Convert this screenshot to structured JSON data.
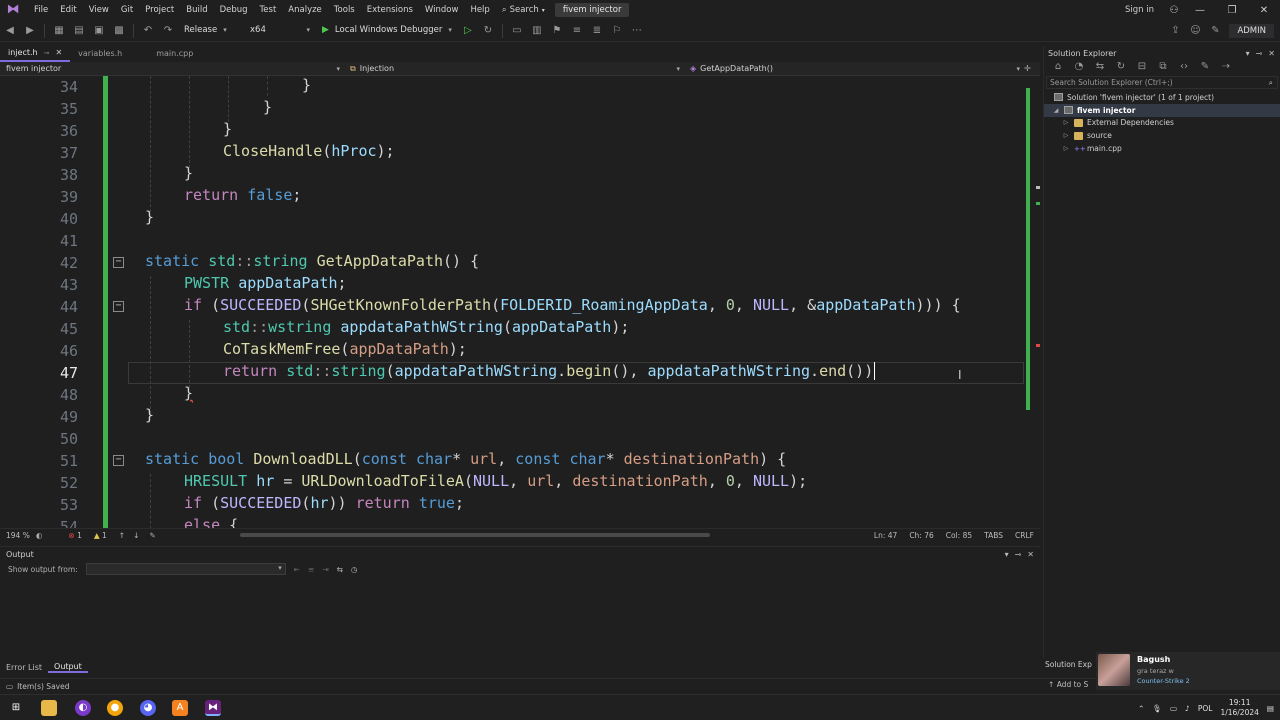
{
  "menubar": {
    "items": [
      "File",
      "Edit",
      "View",
      "Git",
      "Project",
      "Build",
      "Debug",
      "Test",
      "Analyze",
      "Tools",
      "Extensions",
      "Window",
      "Help"
    ],
    "search_label": "Search",
    "project_name": "fivem injector",
    "signin_label": "Sign in"
  },
  "toolbar": {
    "config": "Release",
    "platform": "x64",
    "debugger": "Local Windows Debugger",
    "admin_badge": "ADMIN"
  },
  "tabs": [
    {
      "label": "inject.h",
      "active": true
    },
    {
      "label": "variables.h",
      "active": false
    },
    {
      "label": "main.cpp",
      "active": false
    }
  ],
  "navbar": {
    "project": "fivem injector",
    "scope": "Injection",
    "member": "GetAppDataPath()"
  },
  "editor": {
    "line_numbers": [
      "34",
      "35",
      "36",
      "37",
      "38",
      "39",
      "40",
      "41",
      "42",
      "43",
      "44",
      "45",
      "46",
      "47",
      "48",
      "49",
      "50",
      "51",
      "52",
      "53",
      "54"
    ],
    "current_line": "47",
    "lines": {
      "l34": "}",
      "l35": "}",
      "l36": "}",
      "l37_fn": "CloseHandle",
      "l37_a": "(",
      "l37_v": "hProc",
      "l37_b": ");",
      "l38": "}",
      "l39_kw": "return",
      "l39_v": "false",
      "l39_e": ";",
      "l40": "}",
      "l42_kw": "static",
      "l42_ns": "std",
      "l42_sep": "::",
      "l42_ty": "string",
      "l42_fn": "GetAppDataPath",
      "l42_e": "() {",
      "l43_ty": "PWSTR",
      "l43_v": "appDataPath",
      "l43_e": ";",
      "l44_kw": "if",
      "l44_a": " (",
      "l44_m": "SUCCEEDED",
      "l44_b": "(",
      "l44_fn": "SHGetKnownFolderPath",
      "l44_c": "(",
      "l44_id": "FOLDERID_RoamingAppData",
      "l44_d": ", ",
      "l44_n": "0",
      "l44_f": ", ",
      "l44_nul": "NULL",
      "l44_g": ", &",
      "l44_v": "appDataPath",
      "l44_h": "))) {",
      "l45_ns": "std",
      "l45_sep": "::",
      "l45_ty": "wstring",
      "l45_fn": "appdataPathWString",
      "l45_a": "(",
      "l45_v": "appDataPath",
      "l45_b": ");",
      "l46_fn": "CoTaskMemFree",
      "l46_a": "(",
      "l46_v": "appDataPath",
      "l46_b": ");",
      "l47_kw": "return",
      "l47_ns": "std",
      "l47_sep": "::",
      "l47_ty": "string",
      "l47_a": "(",
      "l47_v1": "appdataPathWString",
      "l47_d1": ".",
      "l47_m1": "begin",
      "l47_b": "(), ",
      "l47_v2": "appdataPathWString",
      "l47_d2": ".",
      "l47_m2": "end",
      "l47_c": "())",
      "l48": "}",
      "l49": "}",
      "l51_kw": "static",
      "l51_ty": "bool",
      "l51_fn": "DownloadDLL",
      "l51_a": "(",
      "l51_k1": "const",
      "l51_t1": "char",
      "l51_s1": "* ",
      "l51_p1": "url",
      "l51_c": ", ",
      "l51_k2": "const",
      "l51_t2": "char",
      "l51_s2": "* ",
      "l51_p2": "destinationPath",
      "l51_e": ") {",
      "l52_ty": "HRESULT",
      "l52_v": "hr",
      "l52_eq": " = ",
      "l52_fn": "URLDownloadToFileA",
      "l52_a": "(",
      "l52_nul": "NULL",
      "l52_b": ", ",
      "l52_p1": "url",
      "l52_c": ", ",
      "l52_p2": "destinationPath",
      "l52_d": ", ",
      "l52_n": "0",
      "l52_e": ", ",
      "l52_nul2": "NULL",
      "l52_f": ");",
      "l53_kw": "if",
      "l53_a": " (",
      "l53_m": "SUCCEEDED",
      "l53_b": "(",
      "l53_v": "hr",
      "l53_c": ")) ",
      "l53_kw2": "return",
      "l53_t": "true",
      "l53_e": ";",
      "l54_kw": "else",
      "l54_e": " {"
    }
  },
  "editor_status": {
    "zoom": "194 %",
    "errors": "1",
    "warnings": "1",
    "ln": "Ln: 47",
    "ch": "Ch: 76",
    "col": "Col: 85",
    "tabs": "TABS",
    "eol": "CRLF"
  },
  "output": {
    "title": "Output",
    "show_from_label": "Show output from:"
  },
  "bottom_tabs": [
    "Error List",
    "Output"
  ],
  "solution_explorer": {
    "title": "Solution Explorer",
    "search_placeholder": "Search Solution Explorer (Ctrl+;)",
    "solution_label": "Solution 'fivem injector' (1 of 1 project)",
    "project_label": "fivem injector",
    "items": [
      "External Dependencies",
      "source",
      "main.cpp"
    ],
    "bottom_tab": "Solution Exp",
    "add_to": "Add to S"
  },
  "statusbar": {
    "message": "Item(s) Saved"
  },
  "notification": {
    "name": "Bagush",
    "sub": "gra teraz w",
    "game": "Counter-Strike 2"
  },
  "taskbar": {
    "lang": "POL",
    "time": "19:11",
    "date": "1/16/2024"
  },
  "colors": {
    "accent": "#7f6bd9",
    "change_bar": "#3fb24f",
    "error": "#e04848"
  }
}
